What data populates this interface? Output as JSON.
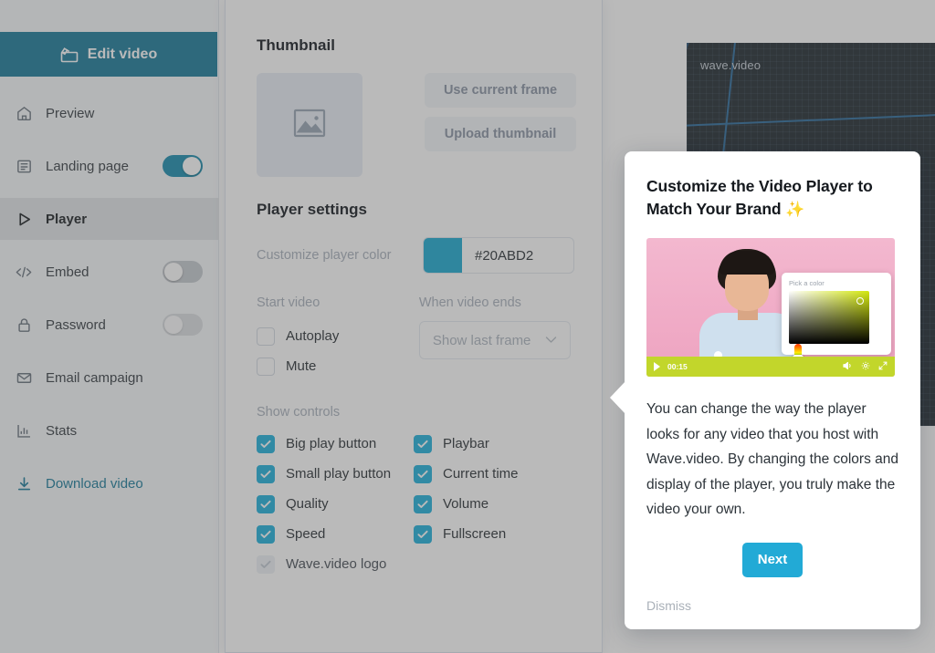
{
  "sidebar": {
    "edit_video_label": "Edit video",
    "items": [
      {
        "id": "preview",
        "label": "Preview",
        "icon": "home-icon",
        "type": "plain",
        "active": false
      },
      {
        "id": "landing-page",
        "label": "Landing page",
        "icon": "article-icon",
        "type": "toggle",
        "toggle_state": "on",
        "active": false
      },
      {
        "id": "player",
        "label": "Player",
        "icon": "play-icon",
        "type": "plain",
        "active": true
      },
      {
        "id": "embed",
        "label": "Embed",
        "icon": "code-icon",
        "type": "toggle",
        "toggle_state": "off",
        "active": false
      },
      {
        "id": "password",
        "label": "Password",
        "icon": "lock-icon",
        "type": "toggle",
        "toggle_state": "off",
        "active": false
      },
      {
        "id": "email-campaign",
        "label": "Email campaign",
        "icon": "envelope-icon",
        "type": "plain",
        "active": false
      },
      {
        "id": "stats",
        "label": "Stats",
        "icon": "bar-chart-icon",
        "type": "plain",
        "active": false
      },
      {
        "id": "download-video",
        "label": "Download video",
        "icon": "download-icon",
        "type": "link",
        "active": false
      }
    ]
  },
  "panel": {
    "thumbnail": {
      "title": "Thumbnail",
      "use_current_frame_label": "Use current frame",
      "upload_thumbnail_label": "Upload thumbnail"
    },
    "player_settings": {
      "title": "Player settings",
      "customize_color_label": "Customize player color",
      "color_value": "#20ABD2",
      "color_swatch": "#20ABD2",
      "start_video_label": "Start video",
      "when_video_ends_label": "When video ends",
      "when_video_ends_value": "Show last frame",
      "start_options": [
        {
          "label": "Autoplay",
          "checked": false
        },
        {
          "label": "Mute",
          "checked": false
        }
      ],
      "show_controls_label": "Show controls",
      "controls_left": [
        {
          "label": "Big play button",
          "checked": true,
          "disabled": false
        },
        {
          "label": "Small play button",
          "checked": true,
          "disabled": false
        },
        {
          "label": "Quality",
          "checked": true,
          "disabled": false
        },
        {
          "label": "Speed",
          "checked": true,
          "disabled": false
        },
        {
          "label": "Wave.video logo",
          "checked": true,
          "disabled": true
        }
      ],
      "controls_right": [
        {
          "label": "Playbar",
          "checked": true,
          "disabled": false
        },
        {
          "label": "Current time",
          "checked": true,
          "disabled": false
        },
        {
          "label": "Volume",
          "checked": true,
          "disabled": false
        },
        {
          "label": "Fullscreen",
          "checked": true,
          "disabled": false
        }
      ]
    }
  },
  "video_preview": {
    "watermark": "wave.video"
  },
  "coachmark": {
    "title": "Customize the Video Player to Match Your Brand ",
    "title_emoji": "✨",
    "media": {
      "picker_label": "Pick a color",
      "playbar_time": "00:15"
    },
    "body": "You can change the way the player looks for any video that you host with Wave.video. By changing the colors and display of the player, you truly make the video your own.",
    "next_label": "Next",
    "dismiss_label": "Dismiss"
  },
  "colors": {
    "accent": "#22AAD6",
    "teal_dark": "#1D7D9C",
    "checkbox": "#22B2DC",
    "player_color": "#20ABD2"
  }
}
